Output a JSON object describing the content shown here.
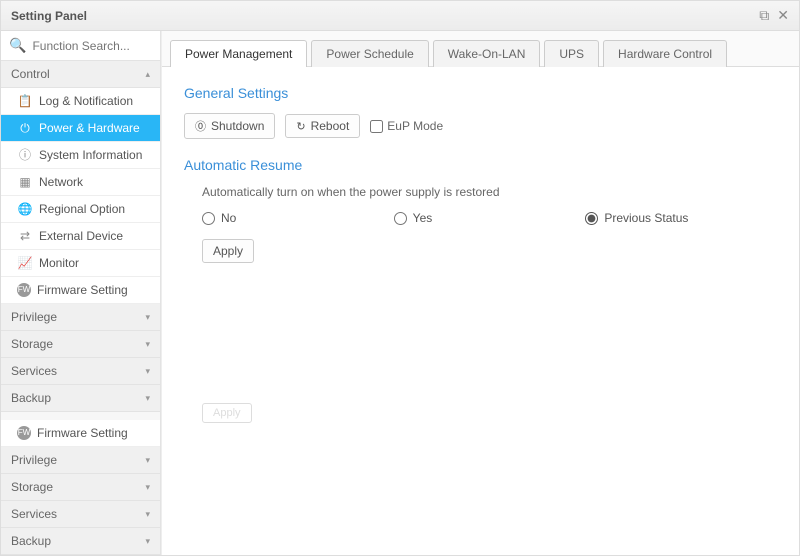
{
  "window": {
    "title": "Setting Panel"
  },
  "search": {
    "placeholder": "Function Search..."
  },
  "sidebar": {
    "sections": [
      {
        "label": "Control",
        "expanded": true,
        "arrow": "▴",
        "items": [
          {
            "icon": "📋",
            "label": "Log & Notification"
          },
          {
            "icon": "⏻",
            "label": "Power & Hardware",
            "selected": true
          },
          {
            "icon": "ⓘ",
            "label": "System Information"
          },
          {
            "icon": "▦",
            "label": "Network"
          },
          {
            "icon": "🌐",
            "label": "Regional Option"
          },
          {
            "icon": "⇄",
            "label": "External Device"
          },
          {
            "icon": "📈",
            "label": "Monitor"
          },
          {
            "icon": "FW",
            "label": "Firmware Setting"
          }
        ]
      },
      {
        "label": "Privilege",
        "expanded": false,
        "arrow": "▾"
      },
      {
        "label": "Storage",
        "expanded": false,
        "arrow": "▾"
      },
      {
        "label": "Services",
        "expanded": false,
        "arrow": "▾"
      },
      {
        "label": "Backup",
        "expanded": false,
        "arrow": "▾"
      }
    ],
    "repeat": [
      {
        "icon": "FW",
        "label": "Firmware Setting"
      },
      {
        "label": "Privilege",
        "arrow": "▾"
      },
      {
        "label": "Storage",
        "arrow": "▾"
      },
      {
        "label": "Services",
        "arrow": "▾"
      },
      {
        "label": "Backup",
        "arrow": "▾"
      }
    ]
  },
  "tabs": [
    {
      "label": "Power Management",
      "active": true
    },
    {
      "label": "Power Schedule"
    },
    {
      "label": "Wake-On-LAN"
    },
    {
      "label": "UPS"
    },
    {
      "label": "Hardware Control"
    }
  ],
  "pane": {
    "section1_title": "General Settings",
    "shutdown_label": "Shutdown",
    "reboot_label": "Reboot",
    "eup_label": "EuP Mode",
    "section2_title": "Automatic Resume",
    "desc": "Automatically turn on when the power supply is restored",
    "radios": {
      "no": "No",
      "yes": "Yes",
      "prev": "Previous Status",
      "selected": "prev"
    },
    "apply_label": "Apply",
    "ghost_label": "Apply"
  }
}
